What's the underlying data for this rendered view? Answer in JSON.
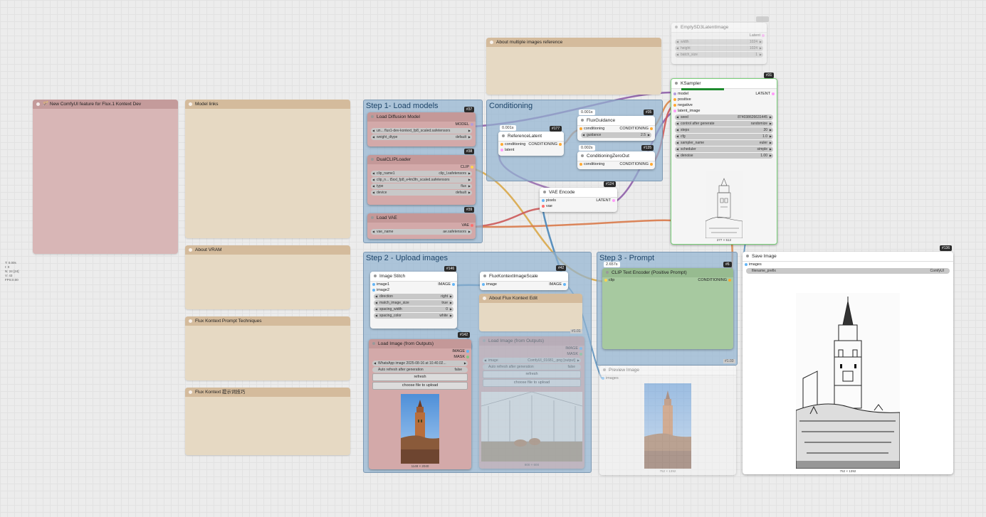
{
  "stats": [
    "T: 0.00s",
    "I: 0",
    "N: 24 [24]",
    "V: 43",
    "FPS:0.00"
  ],
  "notes": {
    "new_feature": "🪄 New ComfyUI feature for Flux.1 Kontext Dev",
    "model_links": "Model links",
    "about_vram": "About VRAM",
    "prompt_techniques": "Flux Kontext Prompt Techniques",
    "kontext_cn": "Flux Kontext 提示词技巧",
    "multiple_images": "About multiple images reference",
    "about_edit": "About Flux Kontext Edit"
  },
  "groups": {
    "step1": "Step 1- Load models",
    "conditioning": "Conditioning",
    "step2": "Step 2 - Upload images",
    "step3": "Step 3 - Prompt"
  },
  "nodes": {
    "load_diffusion": {
      "title": "Load Diffusion Model",
      "badge": "#37",
      "out": "MODEL",
      "unet": "un... flux1-dev-kontext_fp8_scaled.safetensors",
      "weight_label": "weight_dtype",
      "weight_value": "default"
    },
    "dual_clip": {
      "title": "DualCLIPLoader",
      "badge": "#38",
      "out": "CLIP",
      "clip1_label": "clip_name1",
      "clip1_value": "clip_l.safetensors",
      "clip2": "clip_n... t5xxl_fp8_e4m3fn_scaled.safetensors",
      "type_label": "type",
      "type_value": "flux",
      "device_label": "device",
      "device_value": "default"
    },
    "load_vae": {
      "title": "Load VAE",
      "badge": "#39",
      "out": "VAE",
      "vae_label": "vae_name",
      "vae_value": "ae.safetensors"
    },
    "reference_latent": {
      "title": "ReferenceLatent",
      "badge": "#177",
      "time": "0.001s",
      "in1": "conditioning",
      "out": "CONDITIONING",
      "in2": "latent"
    },
    "flux_guidance": {
      "title": "FluxGuidance",
      "badge": "#35",
      "time": "0.001s",
      "in": "conditioning",
      "out": "CONDITIONING",
      "g_label": "guidance",
      "g_value": "2.5"
    },
    "cond_zero": {
      "title": "ConditioningZeroOut",
      "badge": "#135",
      "time": "0.002s",
      "in": "conditioning",
      "out": "CONDITIONING"
    },
    "vae_encode": {
      "title": "VAE Encode",
      "badge": "#124",
      "in1": "pixels",
      "out": "LATENT",
      "in2": "vae"
    },
    "ksampler": {
      "title": "KSampler",
      "badge": "#31",
      "in_model": "model",
      "out": "LATENT",
      "in_pos": "positive",
      "in_neg": "negative",
      "in_lat": "latent_image",
      "widgets": [
        [
          "seed",
          "874038626631445"
        ],
        [
          "control after generate",
          "randomize"
        ],
        [
          "steps",
          "20"
        ],
        [
          "cfg",
          "1.0"
        ],
        [
          "sampler_name",
          "euler"
        ],
        [
          "scheduler",
          "simple"
        ],
        [
          "denoise",
          "1.00"
        ]
      ],
      "caption": "277 × 512"
    },
    "empty_latent": {
      "title": "EmptySD3LatentImage",
      "out": "Latent",
      "widgets": [
        [
          "width",
          "1024"
        ],
        [
          "height",
          "1024"
        ],
        [
          "batch_size",
          "1"
        ]
      ]
    },
    "image_stitch": {
      "title": "Image Stitch",
      "badge": "#146",
      "in1": "image1",
      "out": "IMAGE",
      "in2": "image2",
      "widgets": [
        [
          "direction",
          "right"
        ],
        [
          "match_image_size",
          "true"
        ],
        [
          "spacing_width",
          "0"
        ],
        [
          "spacing_color",
          "white"
        ]
      ]
    },
    "flux_scale": {
      "title": "FluxKontextImageScale",
      "badge": "#42",
      "in": "image",
      "out": "IMAGE"
    },
    "load_image1": {
      "title": "Load Image (from Outputs)",
      "badge": "#142",
      "out1": "IMAGE",
      "out2": "MASK",
      "file": "WhatsApp image 2025-08-16 at 10.40.02...",
      "auto_label": "Auto refresh after generation",
      "auto_value": "false",
      "refresh": "refresh",
      "choose": "choose file to upload",
      "caption": "1148 × 2040"
    },
    "load_image2": {
      "title": "Load Image (from Outputs)",
      "out1": "IMAGE",
      "out2": "MASK",
      "file_label": "image",
      "file_value": "ComfyUI_01681_.png [output]",
      "auto_label": "Auto refresh after generation",
      "auto_value": "false",
      "refresh": "refresh",
      "choose": "choose file to upload",
      "caption": "800 × 600",
      "corner": "#1.01"
    },
    "clip_text": {
      "title": "CLIP Text Encoder (Positive Prompt)",
      "badge": "#6",
      "time": "2.657s",
      "in": "clip",
      "out": "CONDITIONING",
      "corner": "#1.03"
    },
    "preview": {
      "title": "Preview Image",
      "in": "images",
      "caption": "752 × 1392"
    },
    "save": {
      "title": "Save Image",
      "badge": "#136",
      "in": "images",
      "prefix_label": "filename_prefix",
      "prefix_value": "ComfyUI",
      "caption": "752 × 1392"
    }
  },
  "colors": {
    "model": "#b39ddb",
    "clip": "#ffd54f",
    "vae": "#ff6e6e",
    "latent": "#ff9cf9",
    "image": "#64b5f6",
    "cond": "#ffa931",
    "wire_purple": "#8e5ea8",
    "wire_orange": "#d9874a",
    "wire_blue": "#4a86b8",
    "wire_red": "#cc5a5a"
  }
}
